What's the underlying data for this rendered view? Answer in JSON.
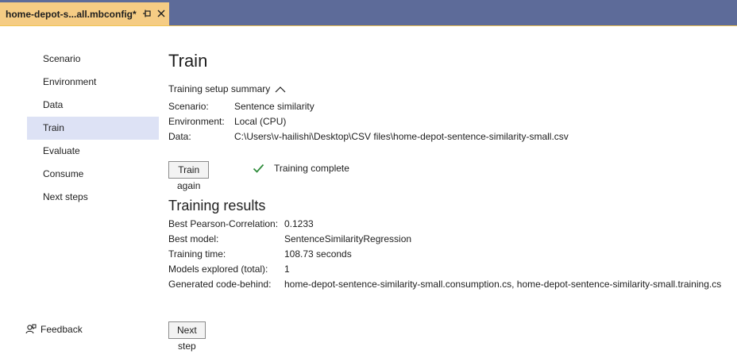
{
  "tab": {
    "title": "home-depot-s...all.mbconfig*",
    "pin_icon": "pin-icon",
    "close_icon": "close-icon"
  },
  "sidebar": {
    "items": [
      {
        "label": "Scenario"
      },
      {
        "label": "Environment"
      },
      {
        "label": "Data"
      },
      {
        "label": "Train",
        "selected": true
      },
      {
        "label": "Evaluate"
      },
      {
        "label": "Consume"
      },
      {
        "label": "Next steps"
      }
    ],
    "feedback_label": "Feedback"
  },
  "main": {
    "title": "Train",
    "summary_toggle": "Training setup summary",
    "summary": {
      "scenario_label": "Scenario:",
      "scenario_value": "Sentence similarity",
      "environment_label": "Environment:",
      "environment_value": "Local (CPU)",
      "data_label": "Data:",
      "data_value": "C:\\Users\\v-hailishi\\Desktop\\CSV files\\home-depot-sentence-similarity-small.csv"
    },
    "train_again_label": "Train again",
    "status_text": "Training complete",
    "results_title": "Training results",
    "results": {
      "metric_label": "Best Pearson-Correlation:",
      "metric_value": "0.1233",
      "model_label": "Best model:",
      "model_value": "SentenceSimilarityRegression",
      "time_label": "Training time:",
      "time_value": "108.73 seconds",
      "explored_label": "Models explored (total):",
      "explored_value": "1",
      "code_label": "Generated code-behind:",
      "code_value": "home-depot-sentence-similarity-small.consumption.cs, home-depot-sentence-similarity-small.training.cs"
    },
    "next_step_label": "Next step"
  },
  "colors": {
    "tabbar": "#5d6b99",
    "active_tab": "#f5cc84",
    "nav_selected": "#dde2f5",
    "success": "#2e8b3a"
  }
}
